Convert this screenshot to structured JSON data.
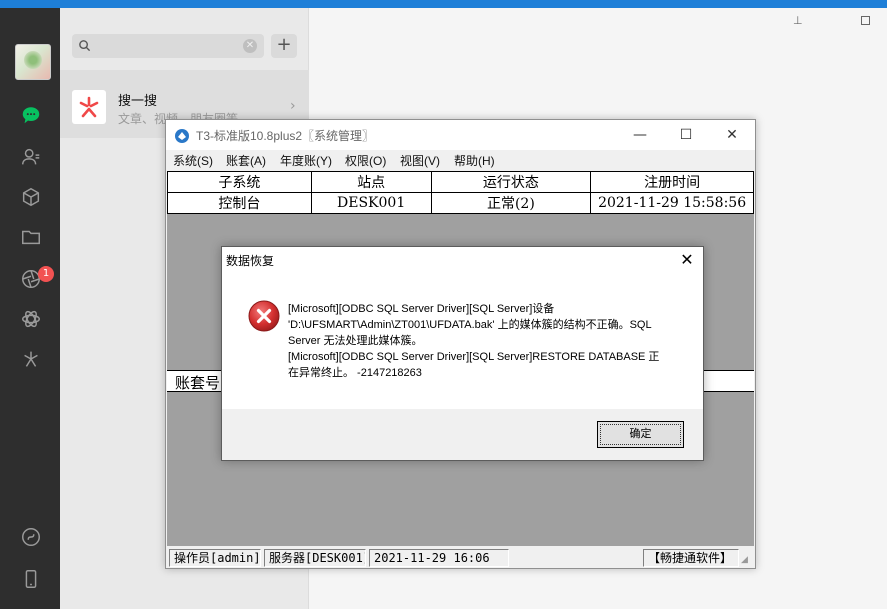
{
  "search": {
    "placeholder": ""
  },
  "sidebar": {
    "icons": [
      "chat-icon",
      "contacts-icon",
      "favorites-icon",
      "files-icon",
      "moments-icon",
      "channels-icon",
      "discover-icon",
      "miniprogram-icon",
      "phone-icon"
    ],
    "moments_badge": "1"
  },
  "chat_list": {
    "items": [
      {
        "title": "搜一搜",
        "subtitle": "文章、视频、朋友圈等"
      }
    ]
  },
  "t3_window": {
    "title": "T3-标准版10.8plus2〖系统管理〗",
    "menu": [
      "系统(S)",
      "账套(A)",
      "年度账(Y)",
      "权限(O)",
      "视图(V)",
      "帮助(H)"
    ],
    "grid": {
      "headers": [
        "子系统",
        "站点",
        "运行状态",
        "注册时间"
      ],
      "rows": [
        [
          "控制台",
          "DESK001",
          "正常(2)",
          "2021-11-29 15:58:56"
        ]
      ]
    },
    "account_header": "账套号",
    "status_bar": [
      "操作员[admin]",
      "服务器[DESK001]",
      "2021-11-29 16:06",
      "【畅捷通软件】"
    ]
  },
  "dialog": {
    "title": "数据恢复",
    "message_lines": [
      "[Microsoft][ODBC SQL Server Driver][SQL Server]设备",
      "'D:\\UFSMART\\Admin\\ZT001\\UFDATA.bak' 上的媒体簇的结构不正确。SQL",
      "Server 无法处理此媒体簇。",
      "[Microsoft][ODBC SQL Server Driver][SQL Server]RESTORE DATABASE 正",
      "在异常终止。 -2147218263"
    ],
    "ok_label": "确定"
  },
  "colors": {
    "rail": "#2e2e2e",
    "wechat_green": "#07c160",
    "error_red": "#d32f2f",
    "grid_gray": "#a0a0a0"
  }
}
